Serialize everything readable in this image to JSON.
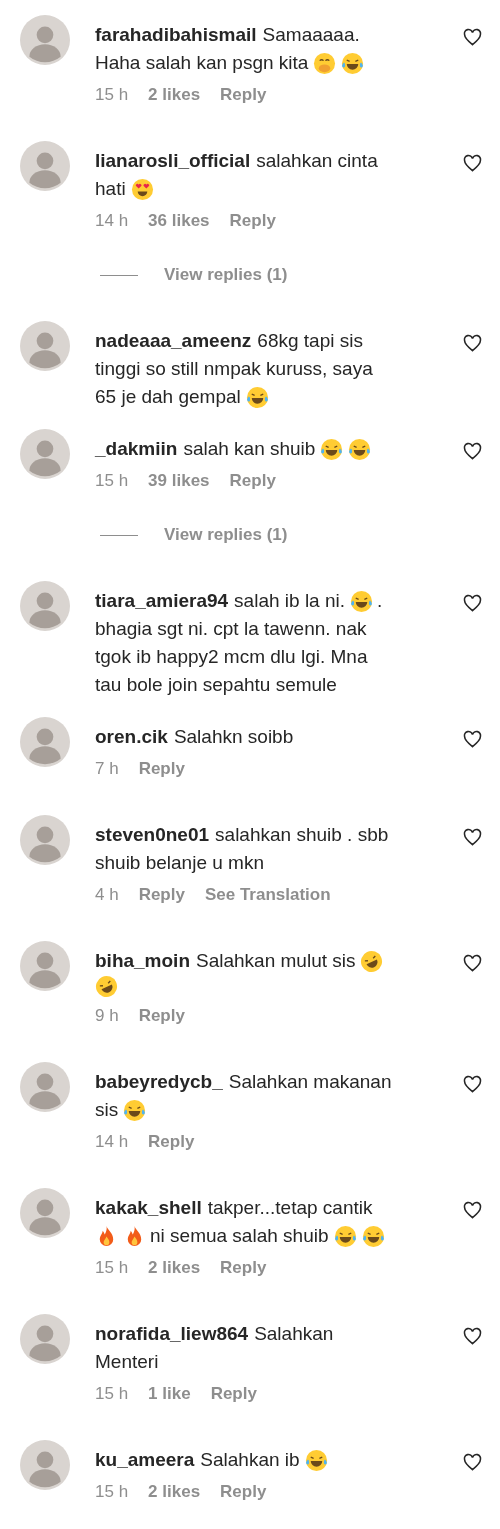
{
  "comments": [
    {
      "username": "farahadibahismail",
      "lines": [
        [
          {
            "kind": "text",
            "text": "Samaaaaa."
          }
        ],
        [
          {
            "kind": "text",
            "text": "Haha salah kan psgn kita"
          },
          {
            "kind": "hand-over-mouth"
          },
          {
            "kind": "laughing"
          }
        ]
      ],
      "meta": {
        "time": "15 h",
        "likes": "2 likes",
        "actions": [
          "Reply"
        ]
      }
    },
    {
      "username": "lianarosli_official",
      "lines": [
        [
          {
            "kind": "text",
            "text": "salahkan cinta"
          }
        ],
        [
          {
            "kind": "text",
            "text": "hati"
          },
          {
            "kind": "heart-eyes"
          }
        ]
      ],
      "meta": {
        "time": "14 h",
        "likes": "36 likes",
        "actions": [
          "Reply"
        ]
      },
      "view_replies": "View replies (1)"
    },
    {
      "username": "nadeaaa_ameenz",
      "lines": [
        [
          {
            "kind": "text",
            "text": "68kg tapi sis"
          }
        ],
        [
          {
            "kind": "text",
            "text": "tinggi so still nmpak kuruss, saya"
          }
        ],
        [
          {
            "kind": "text",
            "text": "65 je dah gempal"
          },
          {
            "kind": "laughing"
          }
        ]
      ]
    },
    {
      "username": "_dakmiin",
      "lines": [
        [
          {
            "kind": "text",
            "text": "salah kan shuib"
          },
          {
            "kind": "laughing"
          },
          {
            "kind": "laughing"
          }
        ]
      ],
      "meta": {
        "time": "15 h",
        "likes": "39 likes",
        "actions": [
          "Reply"
        ]
      },
      "view_replies": "View replies (1)"
    },
    {
      "username": "tiara_amiera94",
      "lines": [
        [
          {
            "kind": "text",
            "text": "salah ib la ni."
          },
          {
            "kind": "laughing"
          },
          {
            "kind": "text",
            "text": "."
          }
        ],
        [
          {
            "kind": "text",
            "text": "bhagia sgt ni. cpt la tawenn. nak"
          }
        ],
        [
          {
            "kind": "text",
            "text": "tgok ib happy2 mcm dlu lgi. Mna"
          }
        ],
        [
          {
            "kind": "text",
            "text": "tau bole join sepahtu semule"
          }
        ]
      ]
    },
    {
      "username": "oren.cik",
      "lines": [
        [
          {
            "kind": "text",
            "text": "Salahkn soibb"
          }
        ]
      ],
      "meta": {
        "time": "7 h",
        "actions": [
          "Reply"
        ]
      }
    },
    {
      "username": "steven0ne01",
      "lines": [
        [
          {
            "kind": "text",
            "text": "salahkan shuib . sbb"
          }
        ],
        [
          {
            "kind": "text",
            "text": "shuib belanje u mkn"
          }
        ]
      ],
      "meta": {
        "time": "4 h",
        "actions": [
          "Reply",
          "See Translation"
        ]
      }
    },
    {
      "username": "biha_moin",
      "lines": [
        [
          {
            "kind": "text",
            "text": "Salahkan mulut sis"
          },
          {
            "kind": "rolling"
          }
        ],
        [
          {
            "kind": "rolling"
          }
        ]
      ],
      "meta": {
        "time": "9 h",
        "actions": [
          "Reply"
        ]
      }
    },
    {
      "username": "babeyredycb_",
      "lines": [
        [
          {
            "kind": "text",
            "text": "Salahkan makanan"
          }
        ],
        [
          {
            "kind": "text",
            "text": "sis"
          },
          {
            "kind": "laughing"
          }
        ]
      ],
      "meta": {
        "time": "14 h",
        "actions": [
          "Reply"
        ]
      }
    },
    {
      "username": "kakak_shell",
      "lines": [
        [
          {
            "kind": "text",
            "text": "takper...tetap cantik"
          }
        ],
        [
          {
            "kind": "fire"
          },
          {
            "kind": "fire"
          },
          {
            "kind": "text",
            "text": "ni semua salah shuib"
          },
          {
            "kind": "laughing"
          },
          {
            "kind": "laughing"
          }
        ]
      ],
      "meta": {
        "time": "15 h",
        "likes": "2 likes",
        "actions": [
          "Reply"
        ]
      }
    },
    {
      "username": "norafida_liew864",
      "lines": [
        [
          {
            "kind": "text",
            "text": "Salahkan"
          }
        ],
        [
          {
            "kind": "text",
            "text": "Menteri"
          }
        ]
      ],
      "meta": {
        "time": "15 h",
        "likes": "1 like",
        "actions": [
          "Reply"
        ]
      }
    },
    {
      "username": "ku_ameera",
      "lines": [
        [
          {
            "kind": "text",
            "text": "Salahkan ib"
          },
          {
            "kind": "laughing"
          }
        ]
      ],
      "meta": {
        "time": "15 h",
        "likes": "2 likes",
        "actions": [
          "Reply"
        ]
      }
    }
  ]
}
